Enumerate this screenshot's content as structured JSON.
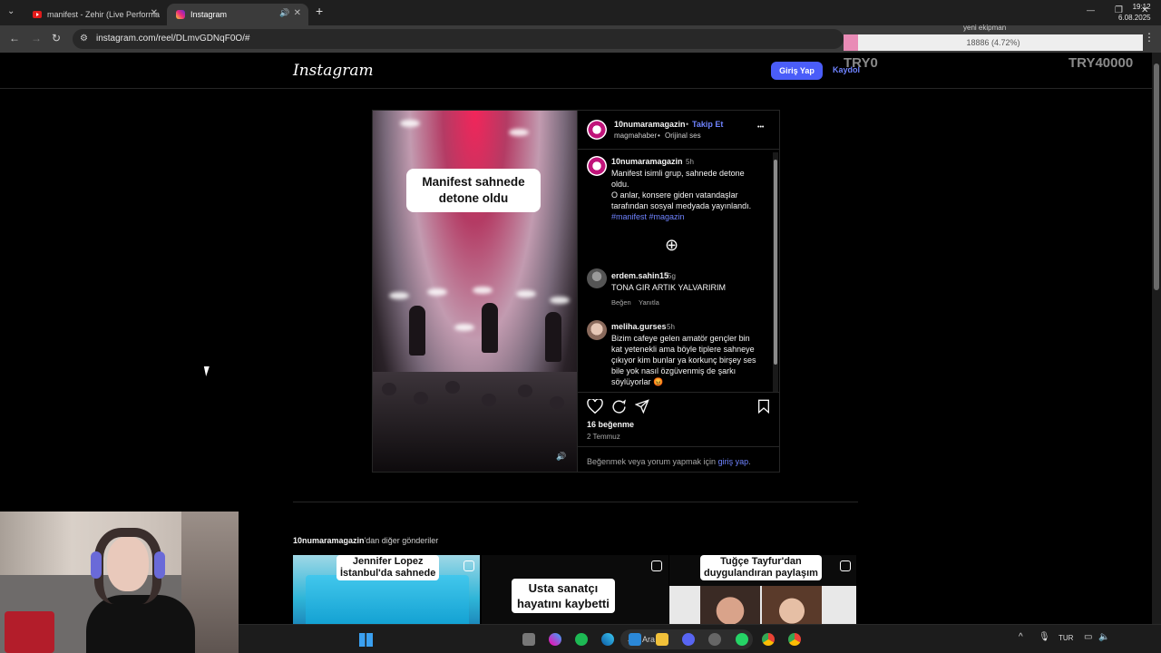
{
  "browser": {
    "tabs": [
      {
        "title": "manifest - Zehir (Live Performa",
        "active": false
      },
      {
        "title": "Instagram",
        "active": true
      }
    ],
    "new_tab": "+",
    "url": "instagram.com/reel/DLmvGDNqF0O/#",
    "win_minimize": "—",
    "win_restore": "❐",
    "win_close": "✕",
    "menu": "⋮"
  },
  "overlay": {
    "title": "yeni ekipman",
    "progress_text": "18886 (4.72%)",
    "progress_percent": 4.72,
    "left_label": "TRY0",
    "right_label": "TRY40000"
  },
  "ig": {
    "logo": "Instagram",
    "login": "Giriş Yap",
    "signup": "Kaydol"
  },
  "post": {
    "video_caption_line1": "Manifest sahnede",
    "video_caption_line2": "detone oldu",
    "author": "10numaramagazin",
    "follow_sep": "•",
    "follow": "Takip Et",
    "sub_user": "magmahaber",
    "sub_sep": "•",
    "audio": "Orijinal ses",
    "more": "•••",
    "caption": {
      "user": "10numaramagazin",
      "time": "5h",
      "lines": [
        "Manifest isimli grup, sahnede detone",
        "oldu.",
        "O anlar, konsere giden vatandaşlar",
        "tarafından sosyal medyada yayınlandı."
      ],
      "hashtags": "#manifest #magazin"
    },
    "load_more": "⊕",
    "comments": [
      {
        "user": "erdem.sahin15",
        "time": "5g",
        "lines": [
          "TONA GIR ARTIK YALVARIRIM"
        ],
        "like": "Beğen",
        "reply": "Yanıtla"
      },
      {
        "user": "meliha.gurses",
        "time": "5h",
        "lines": [
          "Bizim cafeye gelen amatör gençler bin",
          "kat yetenekli ama böyle tiplere sahneye",
          "çıkıyor kim bunlar ya korkunç birşey ses",
          "bile yok nasıl özgüvenmiş de şarkı",
          "söylüyorlar 😡"
        ]
      }
    ],
    "likes": "16 beğenme",
    "date": "2 Temmuz",
    "login_prompt_pre": "Beğenmek veya yorum yapmak için",
    "login_prompt_link": "giriş yap",
    "login_prompt_post": "."
  },
  "more_posts": {
    "heading_user": "10numaramagazin",
    "heading_rest": "'dan diğer gönderiler",
    "items": [
      {
        "line1": "Jennifer Lopez",
        "line2": "İstanbul'da sahnede"
      },
      {
        "line1": "Usta sanatçı",
        "line2": "hayatını kaybetti"
      },
      {
        "line1": "Tuğçe Tayfur'dan",
        "line2": "duygulandıran paylaşım"
      }
    ]
  },
  "taskbar": {
    "search": "Ara",
    "lang": "TUR",
    "time": "19:12",
    "date": "6.08.2025"
  }
}
